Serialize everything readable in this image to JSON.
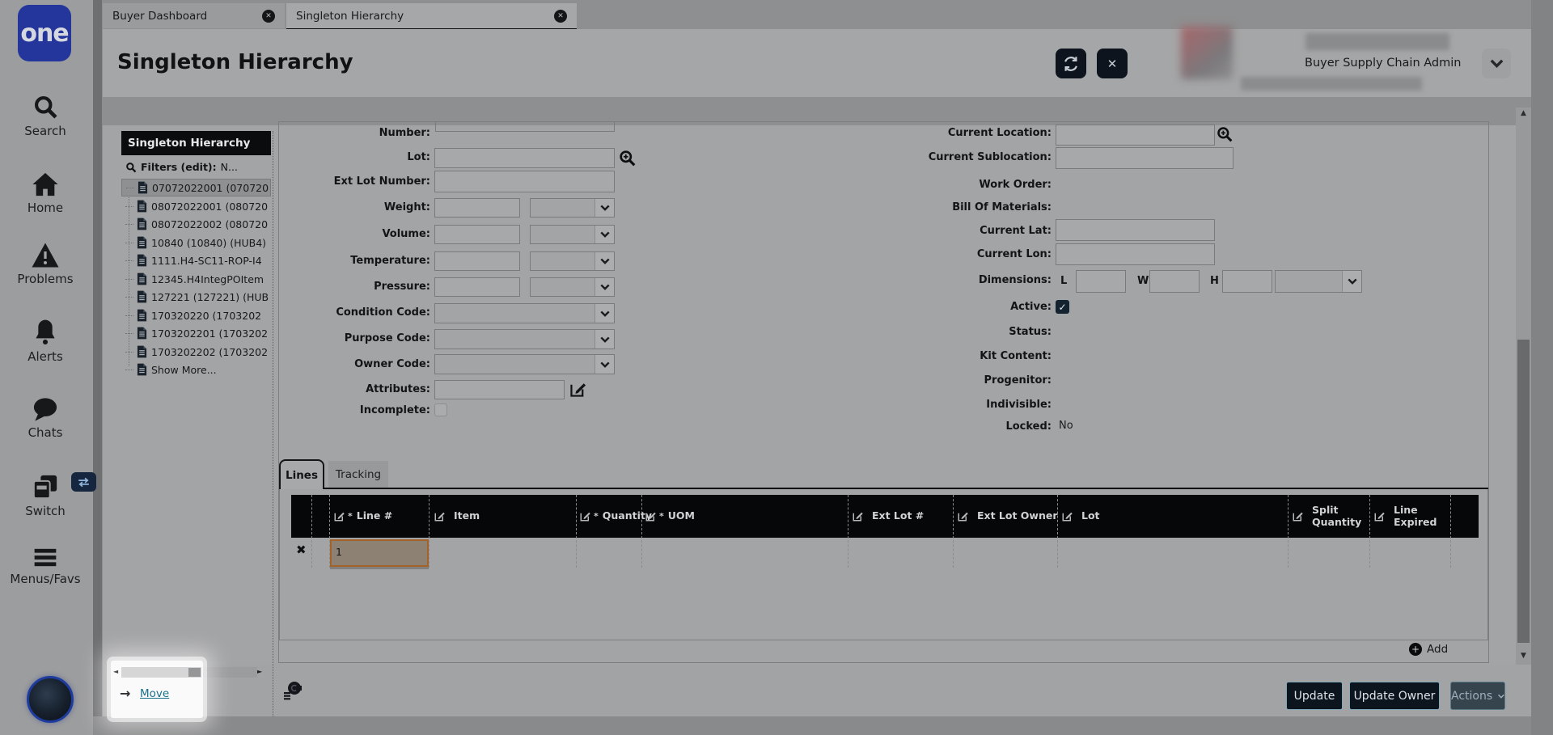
{
  "sidebar": {
    "logo": "one",
    "items": [
      {
        "label": "Search"
      },
      {
        "label": "Home"
      },
      {
        "label": "Problems"
      },
      {
        "label": "Alerts"
      },
      {
        "label": "Chats"
      },
      {
        "label": "Switch"
      },
      {
        "label": "Menus/Favs"
      }
    ]
  },
  "tabs": {
    "tab1": "Buyer Dashboard",
    "tab2": "Singleton Hierarchy"
  },
  "header": {
    "title": "Singleton Hierarchy",
    "user_role": "Buyer Supply Chain Admin"
  },
  "tree": {
    "title": "Singleton Hierarchy",
    "filters_label": "Filters (edit):",
    "filters_value": "N...",
    "items": [
      "07072022001 (070720",
      "08072022001 (080720",
      "08072022002 (080720",
      "10840 (10840) (HUB4)",
      "1111.H4-SC11-ROP-I4",
      "12345.H4IntegPOItem",
      "127221 (127221) (HUB",
      "170320220 (1703202",
      "1703202201 (1703202",
      "1703202202 (1703202"
    ],
    "show_more": "Show More...",
    "move": "Move"
  },
  "form": {
    "labels_left": [
      "Number:",
      "Lot:",
      "Ext Lot Number:",
      "Weight:",
      "Volume:",
      "Temperature:",
      "Pressure:",
      "Condition Code:",
      "Purpose Code:",
      "Owner Code:",
      "Attributes:",
      "Incomplete:"
    ],
    "labels_right": [
      "Current Location:",
      "Current Sublocation:",
      "Work Order:",
      "Bill Of Materials:",
      "Current Lat:",
      "Current Lon:",
      "Dimensions:",
      "Active:",
      "Status:",
      "Kit Content:",
      "Progenitor:",
      "Indivisible:",
      "Locked:"
    ],
    "dims": {
      "l": "L",
      "w": "W",
      "h": "H"
    },
    "locked_value": "No",
    "active_check": "✓"
  },
  "lines": {
    "tab_lines": "Lines",
    "tab_tracking": "Tracking",
    "req_mark": "*",
    "columns": [
      {
        "label": "Line #",
        "req": true
      },
      {
        "label": "Item",
        "req": false
      },
      {
        "label": "Quantity",
        "req": true
      },
      {
        "label": "UOM",
        "req": true
      },
      {
        "label": "Ext Lot #",
        "req": false
      },
      {
        "label": "Ext Lot Owner",
        "req": false
      },
      {
        "label": "Lot",
        "req": false
      },
      {
        "label": "Split Quantity",
        "req": false
      },
      {
        "label": "Line Expired",
        "req": false
      }
    ],
    "row1_line": "1",
    "add": "Add"
  },
  "footer": {
    "update": "Update",
    "update_owner": "Update Owner",
    "actions": "Actions"
  },
  "icons": {
    "close": "✕",
    "plus": "+",
    "delete": "✖",
    "left": "◄",
    "right": "►",
    "up": "▲",
    "down": "▼",
    "move_arrow": "→"
  },
  "colors": {
    "accent_blue": "#24369c",
    "highlight_orange": "#a4622b",
    "button_navy": "#0c141e",
    "link_teal": "#19708a"
  }
}
